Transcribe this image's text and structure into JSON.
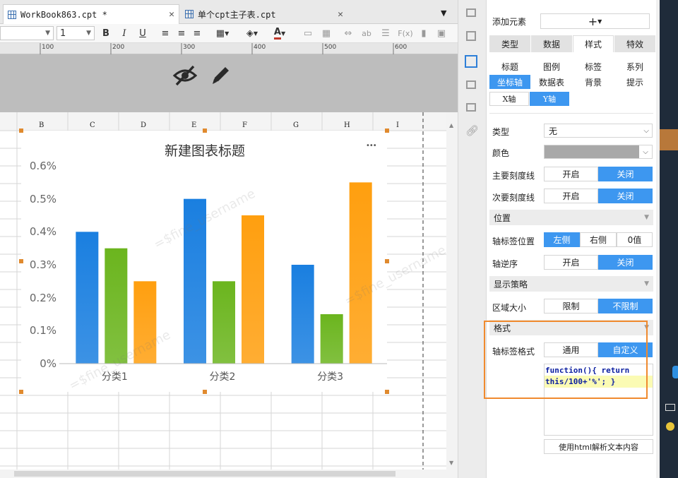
{
  "tabs": [
    {
      "label": "WorkBook863.cpt *",
      "active": true
    },
    {
      "label": "单个cpt主子表.cpt",
      "active": false
    }
  ],
  "toolbar": {
    "font_size": "1",
    "bold": "B",
    "italic": "I",
    "underline": "U",
    "fx": "F(x)",
    "ab": "ab"
  },
  "ruler": {
    "ticks": [
      "100",
      "200",
      "300",
      "400",
      "500",
      "600"
    ]
  },
  "columns": [
    "B",
    "C",
    "D",
    "E",
    "F",
    "G",
    "H",
    "I"
  ],
  "watermark": "=$fine_username",
  "chart_data": {
    "type": "bar",
    "title": "新建图表标题",
    "categories": [
      "分类1",
      "分类2",
      "分类3"
    ],
    "series": [
      {
        "values": [
          0.4,
          0.5,
          0.3
        ],
        "color": "#1a7fe0"
      },
      {
        "values": [
          0.35,
          0.25,
          0.15
        ],
        "color": "#6bb51e"
      },
      {
        "values": [
          0.25,
          0.45,
          0.55
        ],
        "color": "#ff9f0f"
      }
    ],
    "ylim": [
      0,
      0.6
    ],
    "yticks": [
      "0%",
      "0.1%",
      "0.2%",
      "0.3%",
      "0.4%",
      "0.5%",
      "0.6%"
    ],
    "legend": "none",
    "grid": false,
    "more_label": "•••"
  },
  "panel": {
    "add_element_label": "添加元素",
    "add_button": "+",
    "main_tabs": [
      "类型",
      "数据",
      "样式",
      "特效"
    ],
    "sub_tabs_row1": [
      "标题",
      "图例",
      "标签",
      "系列"
    ],
    "sub_tabs_row2": [
      "坐标轴",
      "数据表",
      "背景",
      "提示"
    ],
    "axis_tabs": [
      "X轴",
      "Y轴"
    ],
    "type_label": "类型",
    "type_value": "无",
    "color_label": "颜色",
    "major_tick_label": "主要刻度线",
    "minor_tick_label": "次要刻度线",
    "on_label": "开启",
    "off_label": "关闭",
    "position_section": "位置",
    "axis_label_pos_label": "轴标签位置",
    "pos_options": [
      "左侧",
      "右侧",
      "0值"
    ],
    "axis_reverse_label": "轴逆序",
    "display_section": "显示策略",
    "area_size_label": "区域大小",
    "area_options": [
      "限制",
      "不限制"
    ],
    "format_section": "格式",
    "axis_format_label": "轴标签格式",
    "format_options": [
      "通用",
      "自定义"
    ],
    "code_line1": "function(){ return",
    "code_line2": "this/100+'%'; }",
    "html_parse_button": "使用html解析文本内容"
  },
  "colors": {
    "accent": "#3d97f0",
    "highlight_box": "#f08a2e"
  }
}
